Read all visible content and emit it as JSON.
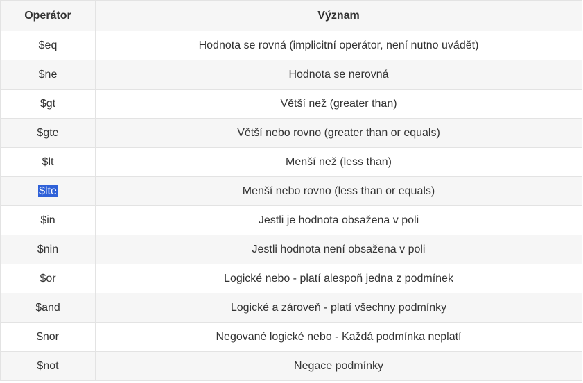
{
  "table": {
    "headers": {
      "operator": "Operátor",
      "meaning": "Význam"
    },
    "rows": [
      {
        "operator": "$eq",
        "meaning": "Hodnota se rovná (implicitní operátor, není nutno uvádět)",
        "selected": false
      },
      {
        "operator": "$ne",
        "meaning": "Hodnota se nerovná",
        "selected": false
      },
      {
        "operator": "$gt",
        "meaning": "Větší než (greater than)",
        "selected": false
      },
      {
        "operator": "$gte",
        "meaning": "Větší nebo rovno (greater than or equals)",
        "selected": false
      },
      {
        "operator": "$lt",
        "meaning": "Menší než (less than)",
        "selected": false
      },
      {
        "operator": "$lte",
        "meaning": "Menší nebo rovno (less than or equals)",
        "selected": true
      },
      {
        "operator": "$in",
        "meaning": "Jestli je hodnota obsažena v poli",
        "selected": false
      },
      {
        "operator": "$nin",
        "meaning": "Jestli hodnota není obsažena v poli",
        "selected": false
      },
      {
        "operator": "$or",
        "meaning": "Logické nebo - platí alespoň jedna z podmínek",
        "selected": false
      },
      {
        "operator": "$and",
        "meaning": "Logické a zároveň - platí všechny podmínky",
        "selected": false
      },
      {
        "operator": "$nor",
        "meaning": "Negované logické nebo - Každá podmínka neplatí",
        "selected": false
      },
      {
        "operator": "$not",
        "meaning": "Negace podmínky",
        "selected": false
      }
    ]
  },
  "colors": {
    "header_bg": "#f6f6f6",
    "row_alt_bg": "#f6f6f6",
    "border": "#e3e3e3",
    "text": "#333333",
    "selection_bg": "#2f61d8"
  }
}
